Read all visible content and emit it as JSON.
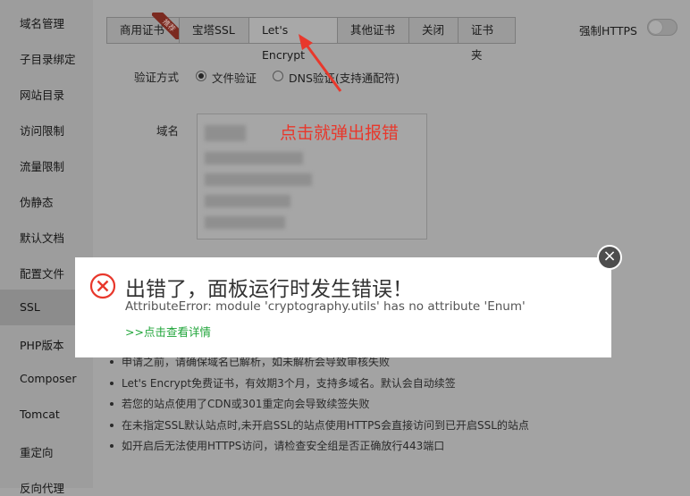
{
  "sidebar": {
    "items": [
      {
        "label": "域名管理"
      },
      {
        "label": "子目录绑定"
      },
      {
        "label": "网站目录"
      },
      {
        "label": "访问限制"
      },
      {
        "label": "流量限制"
      },
      {
        "label": "伪静态"
      },
      {
        "label": "默认文档"
      },
      {
        "label": "配置文件"
      },
      {
        "label": "SSL",
        "active": true
      },
      {
        "label": "PHP版本"
      },
      {
        "label": "Composer"
      },
      {
        "label": "Tomcat"
      },
      {
        "label": "重定向"
      },
      {
        "label": "反向代理"
      }
    ]
  },
  "tabs": [
    {
      "label": "商用证书",
      "badge": "推荐"
    },
    {
      "label": "宝塔SSL"
    },
    {
      "label": "Let's Encrypt",
      "active": true
    },
    {
      "label": "其他证书"
    },
    {
      "label": "关闭"
    },
    {
      "label": "证书夹"
    }
  ],
  "https_toggle": {
    "label": "强制HTTPS",
    "on": false
  },
  "verify": {
    "label": "验证方式",
    "options": [
      {
        "label": "文件验证",
        "checked": true
      },
      {
        "label": "DNS验证(支持通配符)",
        "checked": false
      }
    ]
  },
  "domain": {
    "label": "域名"
  },
  "annotation": "点击就弹出报错",
  "tips": [
    "申请之前，请确保域名已解析，如未解析会导致审核失败",
    "Let's Encrypt免费证书，有效期3个月，支持多域名。默认会自动续签",
    "若您的站点使用了CDN或301重定向会导致续签失败",
    "在未指定SSL默认站点时,未开启SSL的站点使用HTTPS会直接访问到已开启SSL的站点",
    "如开启后无法使用HTTPS访问，请检查安全组是否正确放行443端口"
  ],
  "dialog": {
    "title": "出错了，面板运行时发生错误！",
    "message": "AttributeError: module 'cryptography.utils' has no attribute 'Enum'",
    "link": ">>点击查看详情",
    "error_color": "#e8382c",
    "link_color": "#20a53a"
  }
}
